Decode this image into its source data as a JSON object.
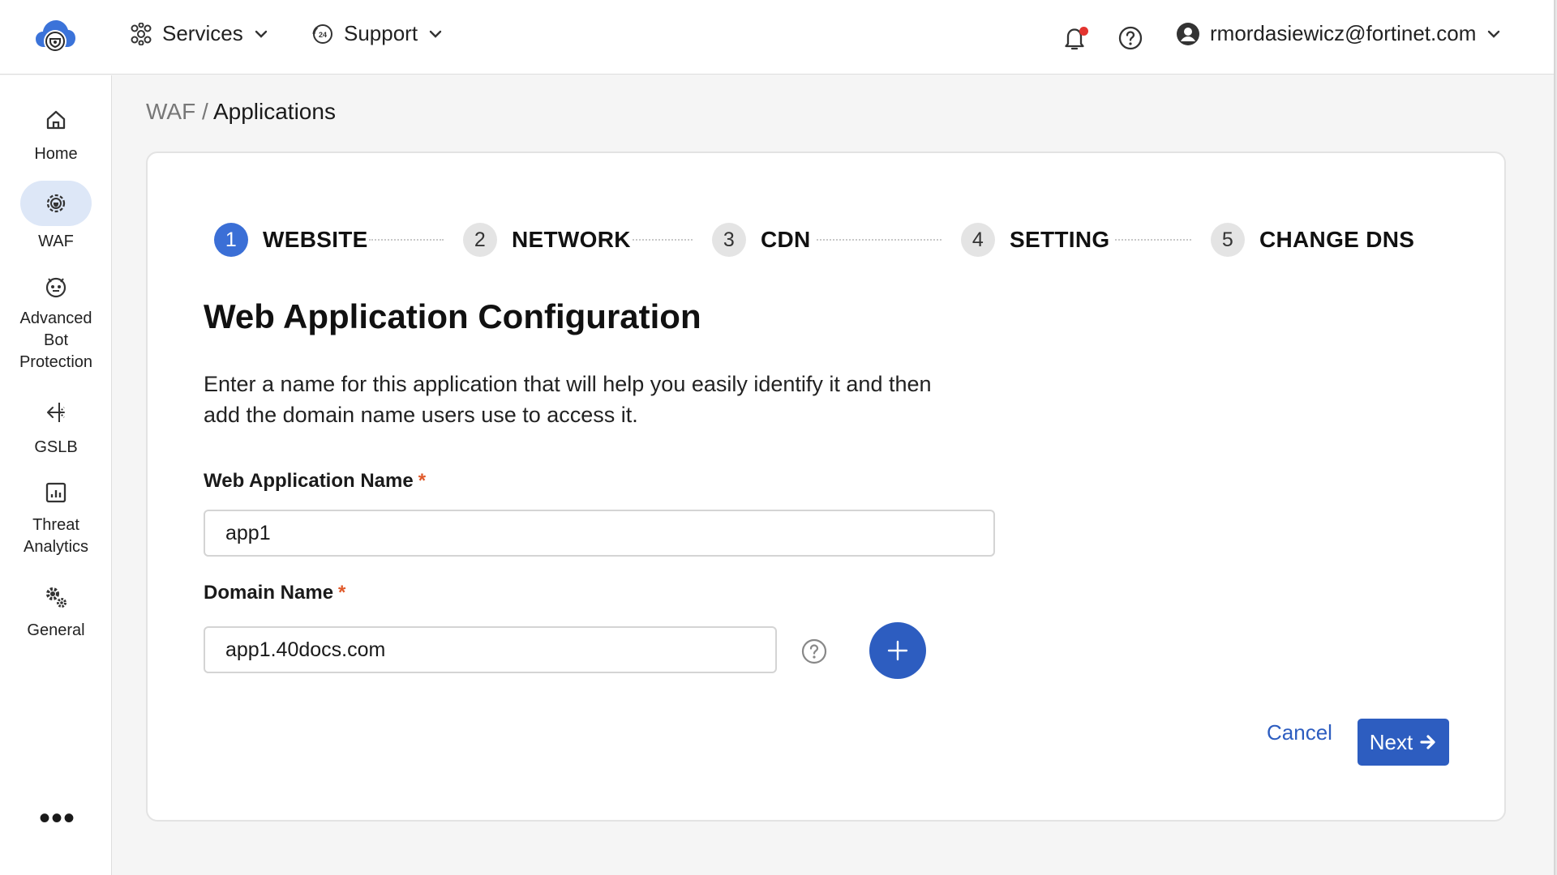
{
  "topbar": {
    "services_label": "Services",
    "support_label": "Support",
    "user_email": "rmordasiewicz@fortinet.com",
    "notification_color": "#e3342f"
  },
  "sidebar": {
    "items": [
      {
        "label": "Home",
        "icon": "home-icon"
      },
      {
        "label": "WAF",
        "icon": "waf-gear-icon",
        "active": true
      },
      {
        "label_lines": [
          "Advanced",
          "Bot",
          "Protection"
        ],
        "icon": "bot-icon"
      },
      {
        "label": "GSLB",
        "icon": "gslb-icon"
      },
      {
        "label_lines": [
          "Threat",
          "Analytics"
        ],
        "icon": "analytics-icon"
      },
      {
        "label": "General",
        "icon": "gears-icon"
      }
    ],
    "more_label": "•••"
  },
  "breadcrumb": {
    "parent": "WAF",
    "separator": "/",
    "current": "Applications"
  },
  "stepper": {
    "steps": [
      {
        "num": "1",
        "label": "WEBSITE",
        "active": true
      },
      {
        "num": "2",
        "label": "NETWORK",
        "active": false
      },
      {
        "num": "3",
        "label": "CDN",
        "active": false
      },
      {
        "num": "4",
        "label": "SETTING",
        "active": false
      },
      {
        "num": "5",
        "label": "CHANGE DNS",
        "active": false
      }
    ]
  },
  "form": {
    "title": "Web Application Configuration",
    "description": "Enter a name for this application that will help you easily identify it and then add the domain name users use to access it.",
    "app_name_label": "Web Application Name",
    "app_name_value": "app1",
    "domain_label": "Domain Name",
    "domain_value": "app1.40docs.com",
    "required_mark": "*",
    "cancel_label": "Cancel",
    "next_label": "Next"
  },
  "colors": {
    "accent": "#2d5dc0",
    "step_active": "#3b6fd6",
    "required": "#e05a2b"
  }
}
